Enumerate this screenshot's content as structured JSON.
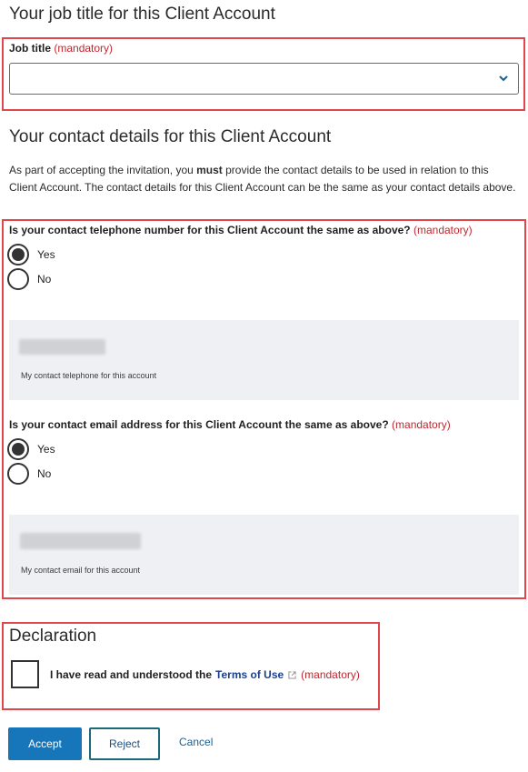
{
  "job_section": {
    "heading": "Your job title for this Client Account",
    "label": "Job title",
    "mandatory": "(mandatory)",
    "select_value": ""
  },
  "contact_section": {
    "heading": "Your contact details for this Client Account",
    "intro_before": "As part of accepting the invitation, you ",
    "intro_bold": "must",
    "intro_after": " provide the contact details to be used in relation to this Client Account. The contact details for this Client Account can be the same as your contact details above.",
    "phone_question": "Is your contact telephone number for this Client Account the same as above?",
    "phone_mandatory": "(mandatory)",
    "phone_options": [
      {
        "label": "Yes",
        "checked": true
      },
      {
        "label": "No",
        "checked": false
      }
    ],
    "phone_caption": "My contact telephone for this account",
    "email_question": "Is your contact email address for this Client Account the same as above?",
    "email_mandatory": "(mandatory)",
    "email_options": [
      {
        "label": "Yes",
        "checked": true
      },
      {
        "label": "No",
        "checked": false
      }
    ],
    "email_caption": "My contact email for this account"
  },
  "declaration": {
    "heading": "Declaration",
    "text": "I have read and understood the",
    "link": "Terms of Use",
    "mandatory": "(mandatory)",
    "checked": false
  },
  "actions": {
    "accept": "Accept",
    "reject": "Reject",
    "cancel": "Cancel"
  },
  "colors": {
    "highlight": "#e0474c",
    "primary": "#1775b9",
    "mandatory": "#c0262d"
  }
}
